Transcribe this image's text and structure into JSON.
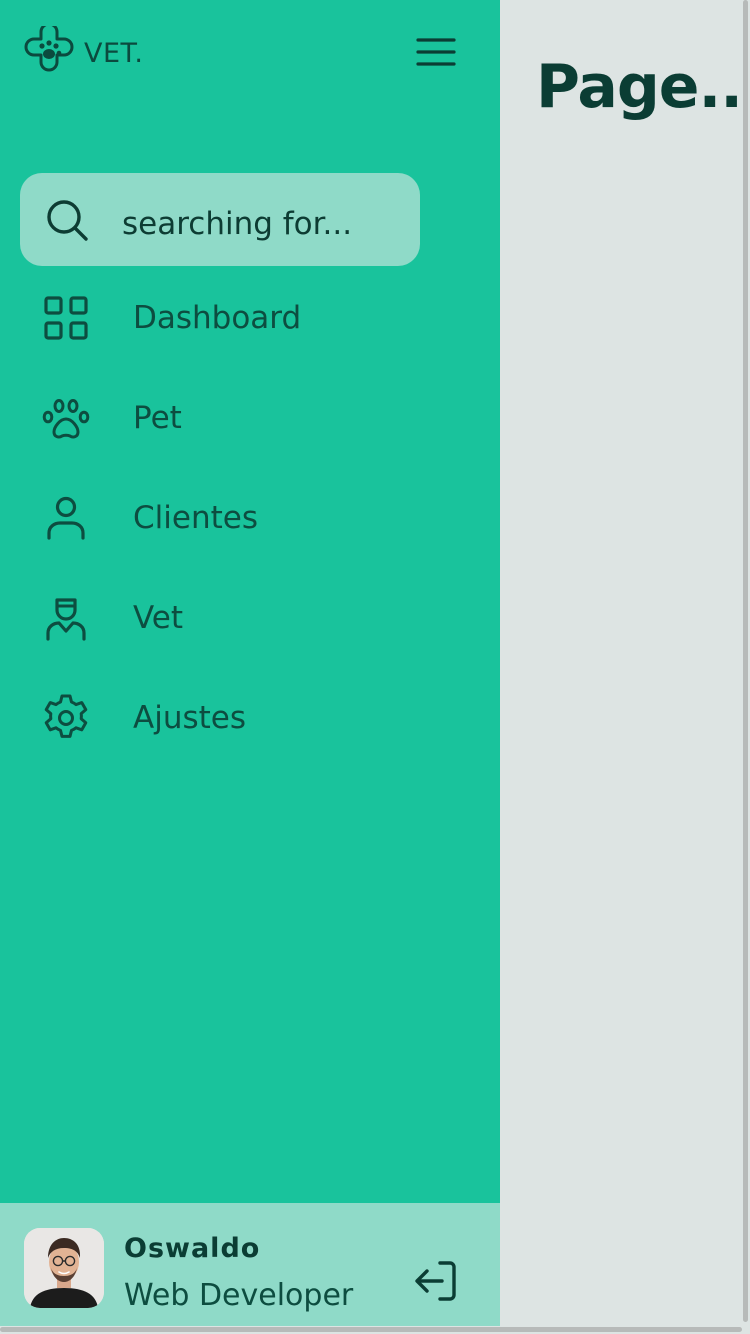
{
  "brand": {
    "name": "VET.",
    "logo_icon": "paw-clover-icon"
  },
  "header": {
    "menu_icon": "hamburger-menu-icon"
  },
  "search": {
    "placeholder": "searching for...",
    "value": "",
    "icon": "search-icon"
  },
  "sidebar": {
    "items": [
      {
        "label": "Dashboard",
        "icon": "grid-icon"
      },
      {
        "label": "Pet",
        "icon": "paw-icon"
      },
      {
        "label": "Clientes",
        "icon": "user-icon"
      },
      {
        "label": "Vet",
        "icon": "doctor-icon"
      },
      {
        "label": "Ajustes",
        "icon": "gear-icon"
      }
    ]
  },
  "user": {
    "name": "Oswaldo",
    "role": "Web Developer",
    "logout_icon": "logout-icon"
  },
  "main": {
    "title": "Page..."
  },
  "colors": {
    "sidebar_bg": "#19c39c",
    "sidebar_light": "#8fdac8",
    "accent_dark": "#0b3d34",
    "main_bg": "#dde4e3"
  }
}
